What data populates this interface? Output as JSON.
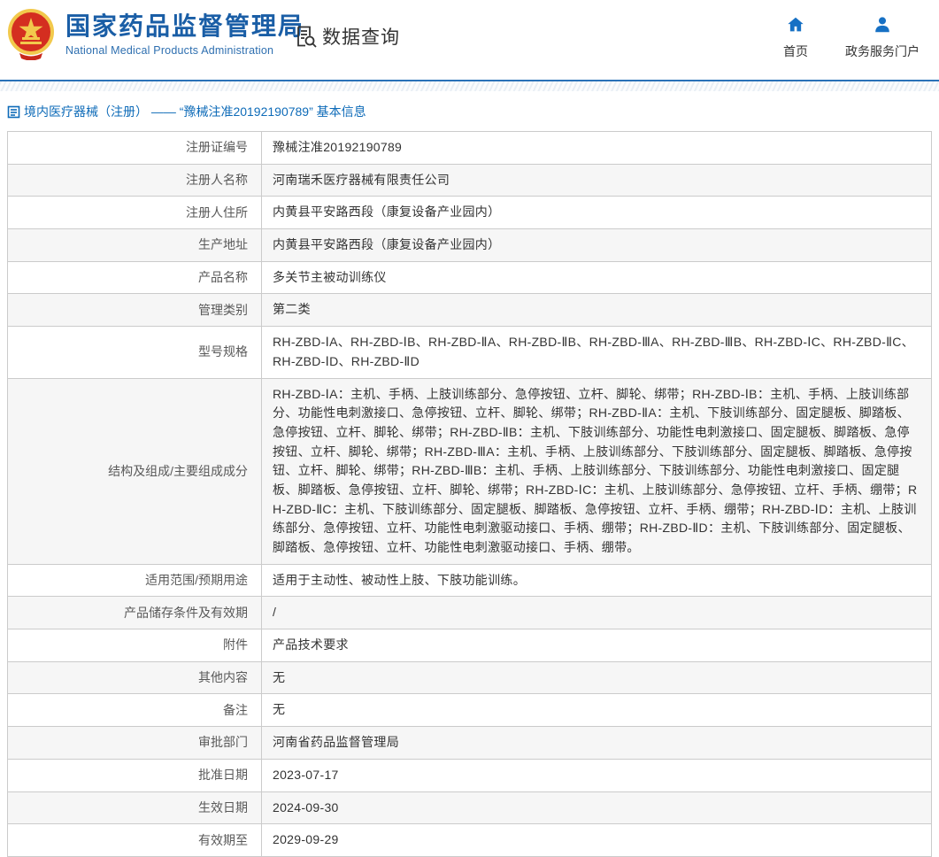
{
  "header": {
    "title": "国家药品监督管理局",
    "subtitle": "National Medical Products Administration",
    "section_label": "数据查询",
    "section_icon": "document-search-icon",
    "logo_icon": "national-emblem",
    "nav": [
      {
        "label": "首页",
        "icon": "home-icon"
      },
      {
        "label": "政务服务门户",
        "icon": "user-icon"
      }
    ]
  },
  "breadcrumb": {
    "icon": "document-list-icon",
    "text": "境内医疗器械（注册） —— “豫械注准20192190789” 基本信息"
  },
  "table": {
    "rows": [
      {
        "label": "注册证编号",
        "value": "豫械注准20192190789"
      },
      {
        "label": "注册人名称",
        "value": "河南瑞禾医疗器械有限责任公司"
      },
      {
        "label": "注册人住所",
        "value": "内黄县平安路西段（康复设备产业园内）"
      },
      {
        "label": "生产地址",
        "value": "内黄县平安路西段（康复设备产业园内）"
      },
      {
        "label": "产品名称",
        "value": "多关节主被动训练仪"
      },
      {
        "label": "管理类别",
        "value": "第二类"
      },
      {
        "label": "型号规格",
        "value": "RH-ZBD-ⅠA、RH-ZBD-ⅠB、RH-ZBD-ⅡA、RH-ZBD-ⅡB、RH-ZBD-ⅢA、RH-ZBD-ⅢB、RH-ZBD-ⅠC、RH-ZBD-ⅡC、RH-ZBD-ⅠD、RH-ZBD-ⅡD"
      },
      {
        "label": "结构及组成/主要组成成分",
        "value": "RH-ZBD-ⅠA：主机、手柄、上肢训练部分、急停按钮、立杆、脚轮、绑带；RH-ZBD-ⅠB：主机、手柄、上肢训练部分、功能性电刺激接口、急停按钮、立杆、脚轮、绑带；RH-ZBD-ⅡA：主机、下肢训练部分、固定腿板、脚踏板、急停按钮、立杆、脚轮、绑带；RH-ZBD-ⅡB：主机、下肢训练部分、功能性电刺激接口、固定腿板、脚踏板、急停按钮、立杆、脚轮、绑带；RH-ZBD-ⅢA：主机、手柄、上肢训练部分、下肢训练部分、固定腿板、脚踏板、急停按钮、立杆、脚轮、绑带；RH-ZBD-ⅢB：主机、手柄、上肢训练部分、下肢训练部分、功能性电刺激接口、固定腿板、脚踏板、急停按钮、立杆、脚轮、绑带；RH-ZBD-ⅠC：主机、上肢训练部分、急停按钮、立杆、手柄、绷带；RH-ZBD-ⅡC：主机、下肢训练部分、固定腿板、脚踏板、急停按钮、立杆、手柄、绷带；RH-ZBD-ⅠD：主机、上肢训练部分、急停按钮、立杆、功能性电刺激驱动接口、手柄、绷带；RH-ZBD-ⅡD：主机、下肢训练部分、固定腿板、脚踏板、急停按钮、立杆、功能性电刺激驱动接口、手柄、绷带。"
      },
      {
        "label": "适用范围/预期用途",
        "value": "适用于主动性、被动性上肢、下肢功能训练。"
      },
      {
        "label": "产品储存条件及有效期",
        "value": "/"
      },
      {
        "label": "附件",
        "value": "产品技术要求"
      },
      {
        "label": "其他内容",
        "value": "无"
      },
      {
        "label": "备注",
        "value": "无"
      },
      {
        "label": "审批部门",
        "value": "河南省药品监督管理局"
      },
      {
        "label": "批准日期",
        "value": "2023-07-17"
      },
      {
        "label": "生效日期",
        "value": "2024-09-30"
      },
      {
        "label": "有效期至",
        "value": "2029-09-29"
      }
    ]
  },
  "colors": {
    "title_blue": "#1a5ea6",
    "nav_icon_blue": "#1670c4",
    "breadcrumb_blue": "#0e6bb8",
    "band_line_blue": "#2a72b8",
    "table_border": "#cbcbcb",
    "alt_row_bg": "#f6f6f6",
    "label_text": "#595959",
    "value_text": "#333333",
    "emblem_red": "#d42e20",
    "emblem_gold": "#f4c row73"
  }
}
